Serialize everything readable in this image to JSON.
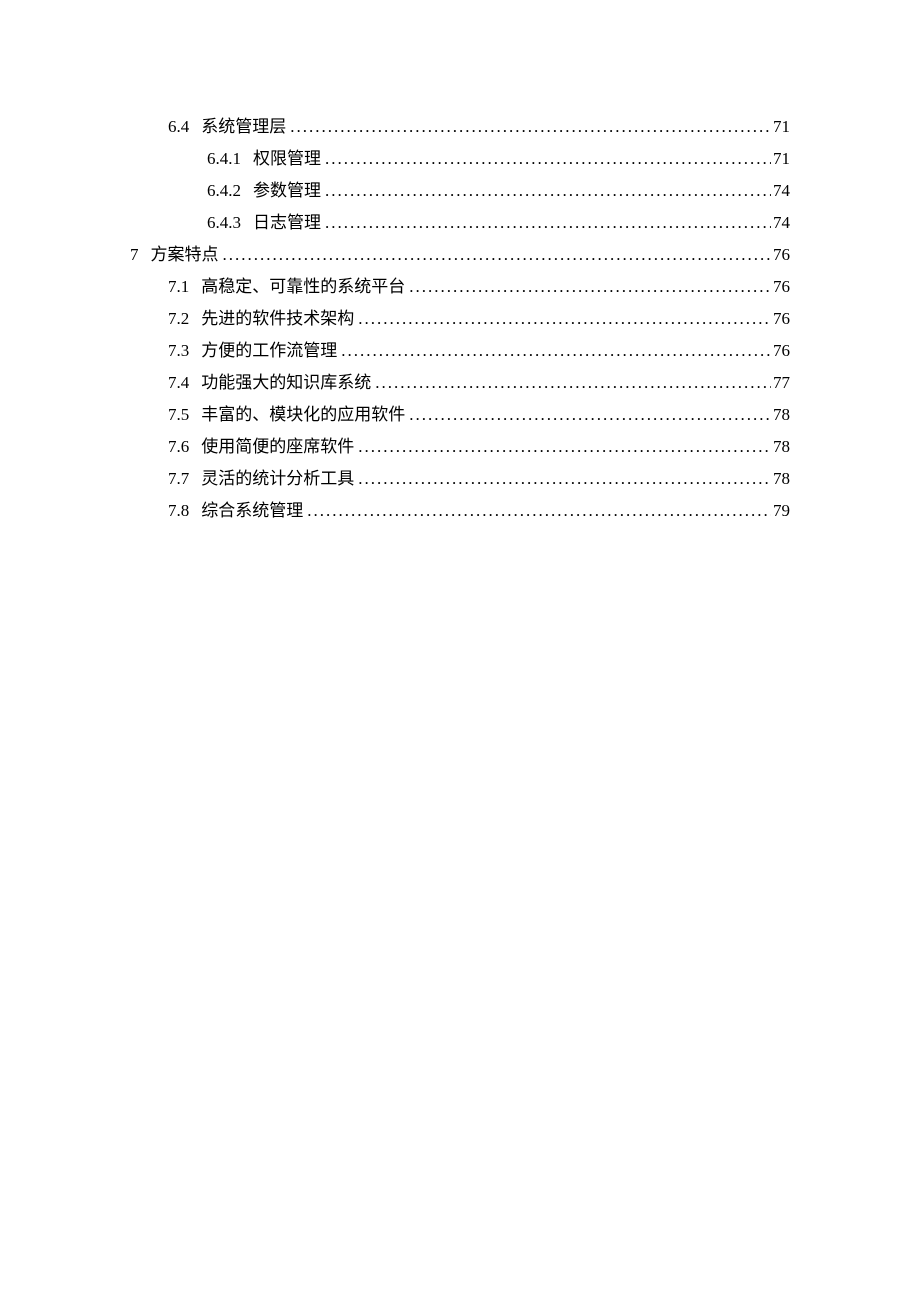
{
  "toc": [
    {
      "level": 2,
      "num": "6.4",
      "title": "系统管理层",
      "page": "71"
    },
    {
      "level": 3,
      "num": "6.4.1",
      "title": "权限管理",
      "page": "71"
    },
    {
      "level": 3,
      "num": "6.4.2",
      "title": "参数管理",
      "page": "74"
    },
    {
      "level": 3,
      "num": "6.4.3",
      "title": "日志管理",
      "page": "74"
    },
    {
      "level": 1,
      "num": "7",
      "title": "方案特点",
      "page": "76"
    },
    {
      "level": 2,
      "num": "7.1",
      "title": "高稳定、可靠性的系统平台",
      "page": "76"
    },
    {
      "level": 2,
      "num": "7.2",
      "title": "先进的软件技术架构",
      "page": "76"
    },
    {
      "level": 2,
      "num": "7.3",
      "title": "方便的工作流管理",
      "page": "76"
    },
    {
      "level": 2,
      "num": "7.4",
      "title": "功能强大的知识库系统",
      "page": "77"
    },
    {
      "level": 2,
      "num": "7.5",
      "title": "丰富的、模块化的应用软件",
      "page": "78"
    },
    {
      "level": 2,
      "num": "7.6",
      "title": "使用简便的座席软件",
      "page": "78"
    },
    {
      "level": 2,
      "num": "7.7",
      "title": "灵活的统计分析工具",
      "page": "78"
    },
    {
      "level": 2,
      "num": "7.8",
      "title": "综合系统管理",
      "page": "79"
    }
  ]
}
